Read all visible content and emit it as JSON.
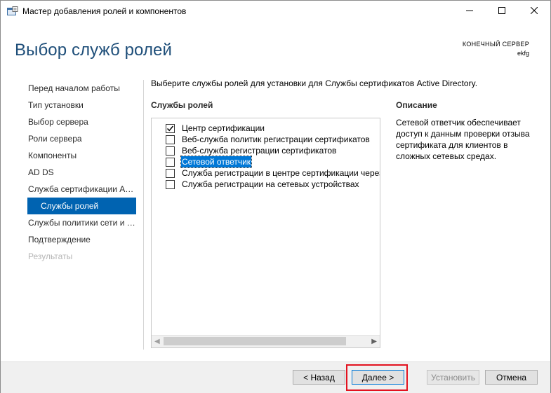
{
  "window": {
    "title": "Мастер добавления ролей и компонентов",
    "icons": [
      "app-icon",
      "minimize-icon",
      "maximize-icon",
      "close-icon"
    ]
  },
  "header": {
    "page_title": "Выбор служб ролей",
    "destination_label": "КОНЕЧНЫЙ СЕРВЕР",
    "destination_server": "ekfg"
  },
  "nav": {
    "items": [
      {
        "label": "Перед началом работы"
      },
      {
        "label": "Тип установки"
      },
      {
        "label": "Выбор сервера"
      },
      {
        "label": "Роли сервера"
      },
      {
        "label": "Компоненты"
      },
      {
        "label": "AD DS"
      },
      {
        "label": "Служба сертификации Active Directory"
      },
      {
        "label": "Службы ролей",
        "state": "active"
      },
      {
        "label": "Службы политики сети и доступа"
      },
      {
        "label": "Подтверждение"
      },
      {
        "label": "Результаты",
        "state": "disabled"
      }
    ]
  },
  "content": {
    "instruction": "Выберите службы ролей для установки для Службы сертификатов Active Directory.",
    "roles_heading": "Службы ролей",
    "roles": [
      {
        "label": "Центр сертификации",
        "checked": true
      },
      {
        "label": "Веб-служба политик регистрации сертификатов",
        "checked": false
      },
      {
        "label": "Веб-служба регистрации сертификатов",
        "checked": false
      },
      {
        "label": "Сетевой ответчик",
        "checked": false,
        "selected": true
      },
      {
        "label": "Служба регистрации в центре сертификации через Интернет",
        "checked": false
      },
      {
        "label": "Служба регистрации на сетевых устройствах",
        "checked": false
      }
    ],
    "description_heading": "Описание",
    "description": "Сетевой ответчик обеспечивает доступ к данным проверки отзыва сертификата для клиентов в сложных сетевых средах."
  },
  "footer": {
    "back_label": "< Назад",
    "next_label": "Далее >",
    "install_label": "Установить",
    "cancel_label": "Отмена"
  },
  "colors": {
    "accent": "#0063b1",
    "title": "#1e4e79",
    "highlight": "#e3121f"
  }
}
